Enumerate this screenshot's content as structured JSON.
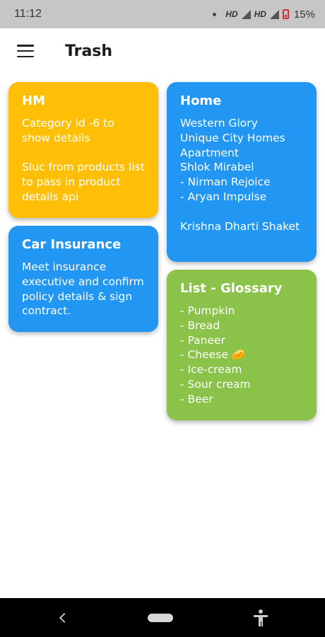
{
  "status_bar": {
    "time": "11:12",
    "hd1": "HD",
    "hd2": "HD",
    "battery": "15%"
  },
  "app_bar": {
    "title": "Trash"
  },
  "notes": [
    {
      "title": "HM",
      "body": "Category id -6 to show details\n\nSluc from products list to pass in product details api",
      "color": "#FFBF06"
    },
    {
      "title": "Car Insurance",
      "body": "Meet insurance executive and confirm policy details & sign contract.",
      "color": "#2196F3"
    },
    {
      "title": "Home",
      "body": "Western Glory\nUnique City Homes Apartment\nShlok Mirabel\n- Nirman Rejoice\n- Aryan Impulse\n\nKrishna Dharti Shaket",
      "color": "#2196F3"
    },
    {
      "title": "List - Glossary",
      "body": "- Pumpkin\n- Bread\n- Paneer\n- Cheese 🧀\n- Ice-cream\n- Sour cream\n- Beer",
      "color": "#8BC34A"
    }
  ],
  "icons": {
    "menu": "menu-icon",
    "back": "back-icon",
    "home": "home-pill-icon",
    "accessibility": "accessibility-icon"
  }
}
